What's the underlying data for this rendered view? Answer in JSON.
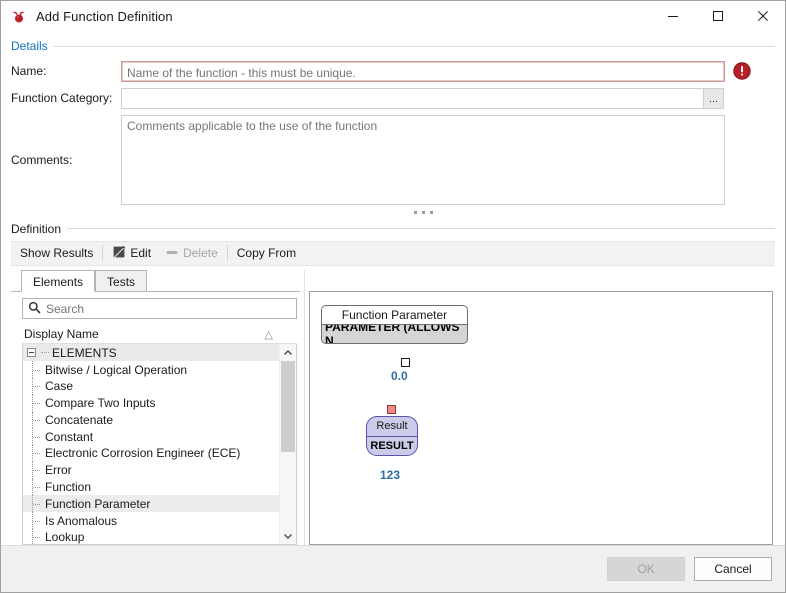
{
  "window": {
    "title": "Add Function Definition",
    "icon": "app-logo-icon",
    "minimize_label": "—",
    "maximize_label": "□",
    "close_label": "✕"
  },
  "details": {
    "group_title": "Details",
    "name_label": "Name:",
    "name_value": "",
    "name_placeholder": "Name of the function - this must be unique.",
    "name_error": true,
    "error_icon": "error-circle-icon",
    "category_label": "Function Category:",
    "category_value": "",
    "category_placeholder": "",
    "browse_label": "...",
    "comments_label": "Comments:",
    "comments_value": "",
    "comments_placeholder": "Comments applicable to the use of the function"
  },
  "definition": {
    "group_title": "Definition",
    "toolbar": [
      {
        "label": "Show Results",
        "icon": "",
        "disabled": false
      },
      {
        "label": "Edit",
        "icon": "pencil-icon",
        "disabled": false
      },
      {
        "label": "Delete",
        "icon": "minus-icon",
        "disabled": true
      },
      {
        "label": "Copy From",
        "icon": "",
        "disabled": false
      }
    ]
  },
  "elements_panel": {
    "tabs": [
      {
        "label": "Elements",
        "active": true
      },
      {
        "label": "Tests",
        "active": false
      }
    ],
    "search_placeholder": "Search",
    "search_value": "",
    "search_icon": "search-icon",
    "column_header": "Display Name",
    "sort_indicator": "△",
    "scroll_up_icon": "chevron-up-icon",
    "scroll_down_icon": "chevron-down-icon",
    "tree": {
      "root_label": "ELEMENTS",
      "items": [
        {
          "label": "Bitwise / Logical Operation",
          "selected": false
        },
        {
          "label": "Case",
          "selected": false
        },
        {
          "label": "Compare Two Inputs",
          "selected": false
        },
        {
          "label": "Concatenate",
          "selected": false
        },
        {
          "label": "Constant",
          "selected": false
        },
        {
          "label": "Electronic Corrosion Engineer (ECE)",
          "selected": false
        },
        {
          "label": "Error",
          "selected": false
        },
        {
          "label": "Function",
          "selected": false
        },
        {
          "label": "Function Parameter",
          "selected": true
        },
        {
          "label": "Is Anomalous",
          "selected": false
        },
        {
          "label": "Lookup",
          "selected": false
        }
      ]
    }
  },
  "canvas": {
    "nodes": [
      {
        "id": "function-parameter",
        "header": "Function Parameter",
        "body": "PARAMETER (ALLOWS N...",
        "value": "0.0",
        "port_style": "white"
      },
      {
        "id": "result",
        "header": "Result",
        "body": "RESULT",
        "value": "123",
        "port_style": "red"
      }
    ]
  },
  "footer": {
    "ok_label": "OK",
    "ok_disabled": true,
    "cancel_label": "Cancel"
  },
  "colors": {
    "group_title_blue": "#0e73c8",
    "error_red": "#c0262b",
    "node_value_blue": "#2e6da4",
    "result_node_fill": "#ccccea",
    "result_node_border": "#5555aa",
    "param_node_fill": "#d4d4d4",
    "error_field_border": "#cb9a95"
  }
}
